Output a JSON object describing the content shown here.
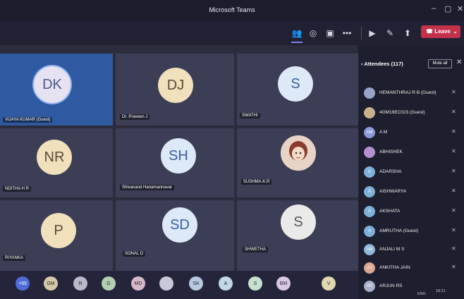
{
  "window": {
    "title": "Microsoft Teams"
  },
  "toolbar": {
    "icons": [
      "people-icon",
      "chat-icon",
      "share-icon",
      "more-icon",
      "camera-icon",
      "mic-icon",
      "share-screen-icon"
    ],
    "leave_label": "Leave"
  },
  "tiles": [
    {
      "initials": "DK",
      "name": "VIJAYA KUMAR (Guest)",
      "active": true,
      "avatar_bg": "#e6e2f2"
    },
    {
      "initials": "DJ",
      "name": "Dr. Praveen J",
      "active": false,
      "avatar_bg": "#f1e0bc"
    },
    {
      "initials": "S",
      "name": "SWATHI",
      "active": false,
      "avatar_bg": "#dde9f7"
    },
    {
      "initials": "NR",
      "name": "NDITHA H R",
      "active": false,
      "avatar_bg": "#f1e0bc"
    },
    {
      "initials": "SH",
      "name": "Shivanand Hanamannavar",
      "active": false,
      "avatar_bg": "#dde9f7"
    },
    {
      "initials": "",
      "name": "SUSHMA.K.R",
      "active": false,
      "avatar_bg": "#e8d3c7"
    },
    {
      "initials": "P",
      "name": "RIYANKA",
      "active": false,
      "avatar_bg": "#f1e0bc"
    },
    {
      "initials": "SD",
      "name": "SONAL D",
      "active": false,
      "avatar_bg": "#dde9f7"
    },
    {
      "initials": "S",
      "name": "SHWETHA",
      "active": false,
      "avatar_bg": "#eaeaea"
    }
  ],
  "strip": [
    {
      "label": "+99",
      "bg": "#4f6bd8"
    },
    {
      "label": "GM",
      "bg": "#d6c8a8"
    },
    {
      "label": "R",
      "bg": "#b8b8c8"
    },
    {
      "label": "G",
      "bg": "#b0d0b0"
    },
    {
      "label": "MD",
      "bg": "#d8b8c8"
    },
    {
      "label": "",
      "bg": "#c8c8d8"
    },
    {
      "label": "SK",
      "bg": "#b8c8e0"
    },
    {
      "label": "A",
      "bg": "#c0d8e8"
    },
    {
      "label": "S",
      "bg": "#c8e0d0"
    },
    {
      "label": "BM",
      "bg": "#d8c8e8"
    },
    {
      "label": "V",
      "bg": "#e0d8b0"
    }
  ],
  "attendees": {
    "title": "Attendees (117)",
    "mute_all_label": "Mute all",
    "list": [
      {
        "initials": "",
        "name": "HEMANTHRAJ R B (Guest)"
      },
      {
        "initials": "",
        "name": "4GM19EC023 (Guest)"
      },
      {
        "initials": "AM",
        "name": "A M"
      },
      {
        "initials": "",
        "name": "ABHISHEK"
      },
      {
        "initials": "A",
        "name": "ADARSHA"
      },
      {
        "initials": "A",
        "name": "AISHWARYA"
      },
      {
        "initials": "A",
        "name": "AKSHATA"
      },
      {
        "initials": "A",
        "name": "AMRUTHA (Guest)"
      },
      {
        "initials": "AM",
        "name": "ANJALI M S"
      },
      {
        "initials": "AJ",
        "name": "ANKITHA JAIN"
      },
      {
        "initials": "AR",
        "name": "ARJUN RS"
      }
    ]
  },
  "taskbar": {
    "lang": "ENG",
    "time": "18:21"
  }
}
